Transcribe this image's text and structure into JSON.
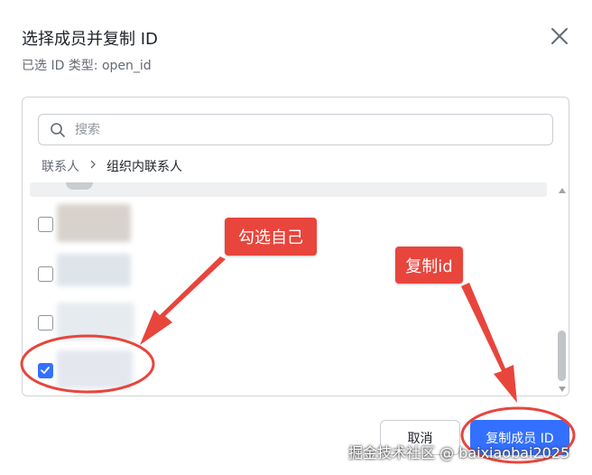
{
  "dialog": {
    "title": "选择成员并复制 ID",
    "subtitle": "已选 ID 类型: open_id"
  },
  "search": {
    "placeholder": "搜索",
    "value": ""
  },
  "breadcrumb": {
    "root": "联系人",
    "separator": ">",
    "current": "组织内联系人"
  },
  "members": [
    {
      "checked": false,
      "avatar_color": "#d8d2cc"
    },
    {
      "checked": false,
      "avatar_color": "#dde4ea"
    },
    {
      "checked": false,
      "avatar_color": "#e6ebf0"
    },
    {
      "checked": true,
      "avatar_color": "#e4e7ee"
    }
  ],
  "footer": {
    "cancel_label": "取消",
    "copy_label": "复制成员 ID"
  },
  "annotations": {
    "select_self": "勾选自己",
    "copy_id": "复制id"
  },
  "watermark": "掘金技术社区 @ baixiaobai2025",
  "colors": {
    "primary": "#3370ff",
    "annotation": "#e8453c"
  }
}
